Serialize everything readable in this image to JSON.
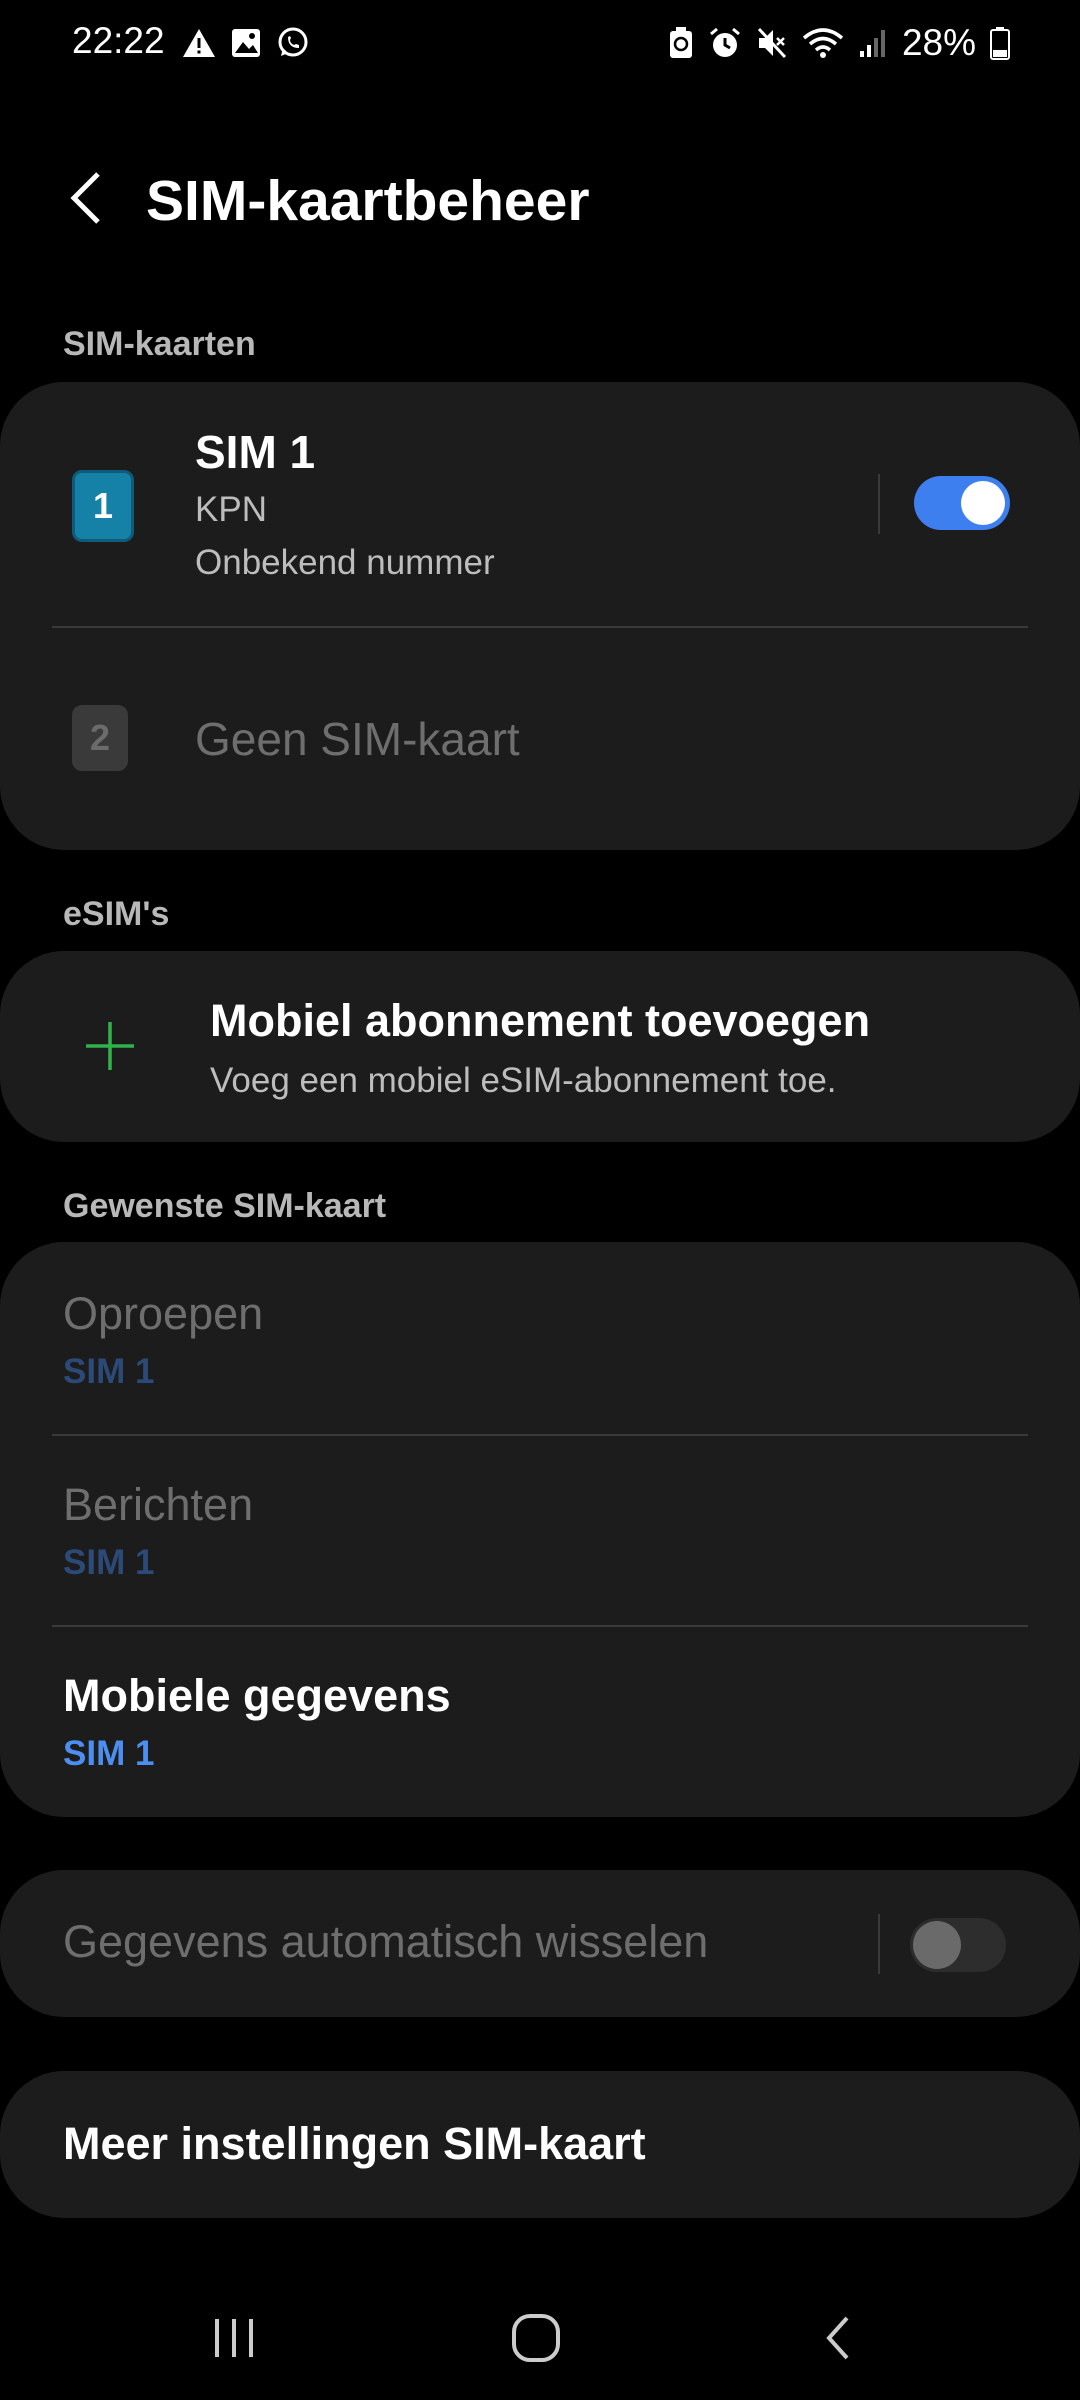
{
  "status_bar": {
    "time": "22:22",
    "battery": "28%",
    "left_icons": [
      "warning-icon",
      "image-icon",
      "whatsapp-icon"
    ],
    "right_icons": [
      "battery-saver-icon",
      "alarm-icon",
      "mute-icon",
      "wifi-icon",
      "signal-icon",
      "battery-icon"
    ]
  },
  "header": {
    "title": "SIM-kaartbeheer"
  },
  "sim_section": {
    "label": "SIM-kaarten",
    "sim1": {
      "badge": "1",
      "name": "SIM 1",
      "carrier": "KPN",
      "number": "Onbekend nummer",
      "enabled": true
    },
    "sim2": {
      "badge": "2",
      "name": "Geen SIM-kaart"
    }
  },
  "esim_section": {
    "label": "eSIM's",
    "add_title": "Mobiel abonnement toevoegen",
    "add_subtitle": "Voeg een mobiel eSIM-abonnement toe."
  },
  "preferred_section": {
    "label": "Gewenste SIM-kaart",
    "items": [
      {
        "title": "Oproepen",
        "value": "SIM 1"
      },
      {
        "title": "Berichten",
        "value": "SIM 1"
      },
      {
        "title": "Mobiele gegevens",
        "value": "SIM 1"
      }
    ]
  },
  "auto_switch": {
    "label": "Gegevens automatisch wisselen",
    "enabled": false
  },
  "more_settings": {
    "label": "Meer instellingen SIM-kaart"
  },
  "colors": {
    "accent": "#3e7ff0",
    "sim1_badge": "#1581a6",
    "esim_plus": "#2fb34a",
    "card": "#1c1c1c"
  }
}
